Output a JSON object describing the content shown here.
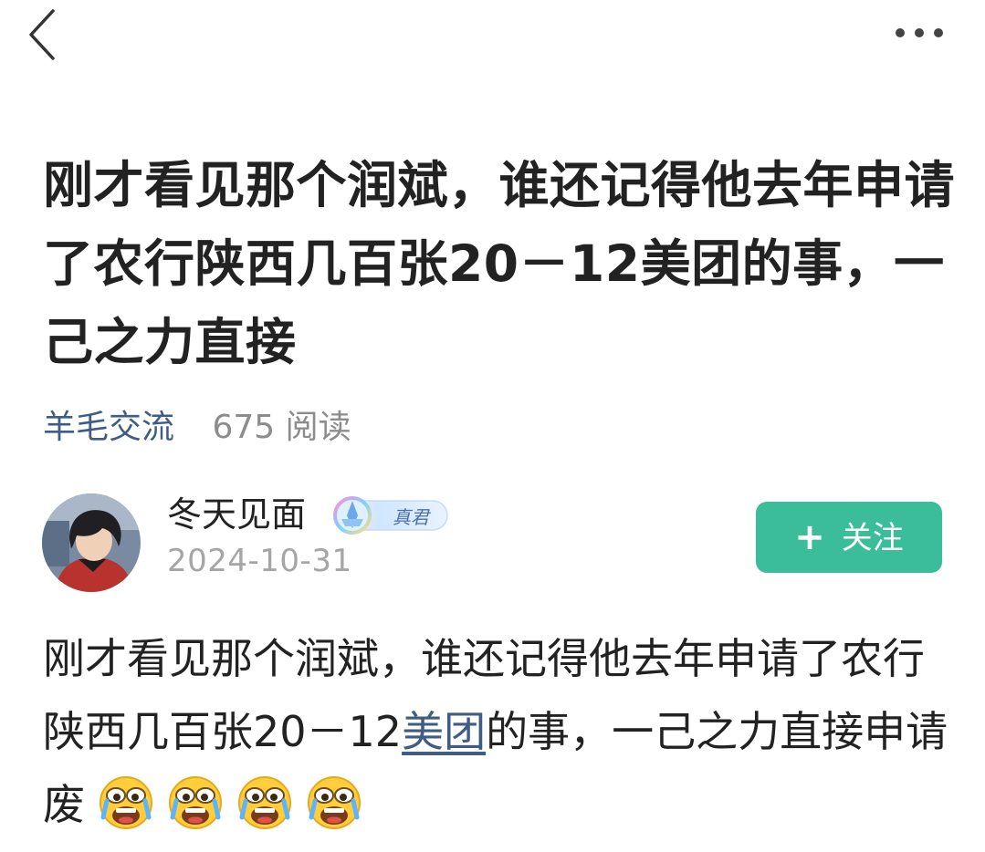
{
  "topbar": {
    "back_icon": "chevron-left-icon",
    "more_icon": "more-dots-icon"
  },
  "post": {
    "title": "刚才看见那个润斌，谁还记得他去年申请了农行陕西几百张20－12美团的事，一己之力直接",
    "category": "羊毛交流",
    "read_count": "675 阅读"
  },
  "author": {
    "name": "冬天见面",
    "badge_icon": "rank-badge-icon",
    "badge_text": "真君",
    "date": "2024-10-31",
    "avatar_icon": "avatar-anime-boy"
  },
  "follow": {
    "plus": "+",
    "label": "关注"
  },
  "content": {
    "text_before": "刚才看见那个润斌，谁还记得他去年申请了农行陕西几百张20－12",
    "link_text": "美团",
    "text_after": "的事，一己之力直接申请废",
    "emoji_name": "crying-face-emoji",
    "emoji_count": 4
  },
  "colors": {
    "accent_blue": "#3e5c84",
    "follow_green": "#3bbd9a",
    "muted_gray": "#8c8c8c"
  }
}
